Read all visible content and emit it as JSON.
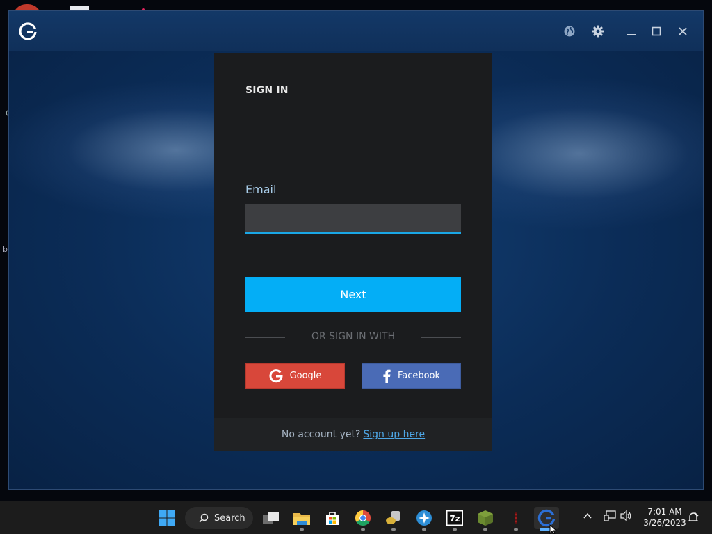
{
  "window": {
    "title_icons": [
      "app-logo-icon",
      "globe-icon",
      "gear-icon",
      "minimize-icon",
      "maximize-icon",
      "close-icon"
    ]
  },
  "signin": {
    "title": "SIGN IN",
    "email_label": "Email",
    "email_value": "",
    "email_placeholder": "",
    "next_label": "Next",
    "divider_text": "OR SIGN IN WITH",
    "google_label": "Google",
    "facebook_label": "Facebook",
    "footer_text": "No account yet?",
    "signup_link": "Sign up here"
  },
  "taskbar": {
    "search_label": "Search",
    "apps": [
      "windows-start-icon",
      "task-view-icon",
      "file-explorer-icon",
      "microsoft-store-icon",
      "chrome-icon",
      "app-icon",
      "app-icon",
      "7zip-icon",
      "minecraft-icon",
      "app-icon",
      "gamebar-app-icon"
    ],
    "time": "7:01 AM",
    "date": "3/26/2023"
  },
  "colors": {
    "accent": "#04aef6",
    "google": "#d8473a",
    "facebook": "#4a6bb6",
    "panel": "#1b1c1e",
    "window_bg": "#0b2c57"
  }
}
